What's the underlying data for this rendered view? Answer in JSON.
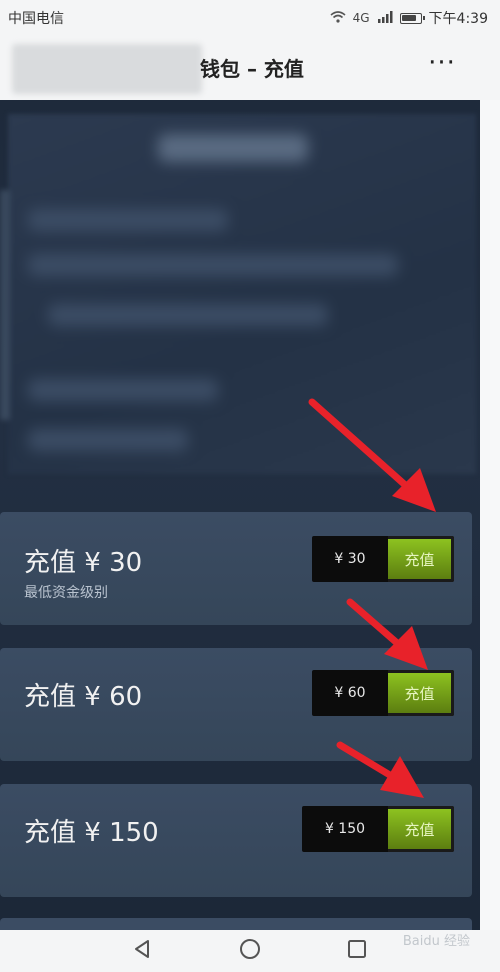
{
  "status_bar": {
    "carrier": "中国电信",
    "signal_text": "4G",
    "time": "下午4:39"
  },
  "header": {
    "title": "钱包 – 充值",
    "more_label": "···"
  },
  "cards": [
    {
      "title": "充值 ¥ 30",
      "subtitle": "最低资金级别",
      "price": "¥ 30",
      "button": "充值"
    },
    {
      "title": "充值 ¥ 60",
      "subtitle": "",
      "price": "¥ 60",
      "button": "充值"
    },
    {
      "title": "充值 ¥ 150",
      "subtitle": "",
      "price": "¥ 150",
      "button": "充值"
    }
  ],
  "watermark": "Baidu 经验",
  "colors": {
    "content_bg": "#1e2a3b",
    "card_bg": "#3b4c63",
    "accent_green": "#8dc220",
    "arrow_red": "#e8222a"
  },
  "icons": {
    "back": "back-triangle-icon",
    "home": "home-circle-icon",
    "recent": "recent-square-icon",
    "wifi": "wifi-icon",
    "signal": "signal-bars-icon",
    "battery": "battery-icon"
  }
}
